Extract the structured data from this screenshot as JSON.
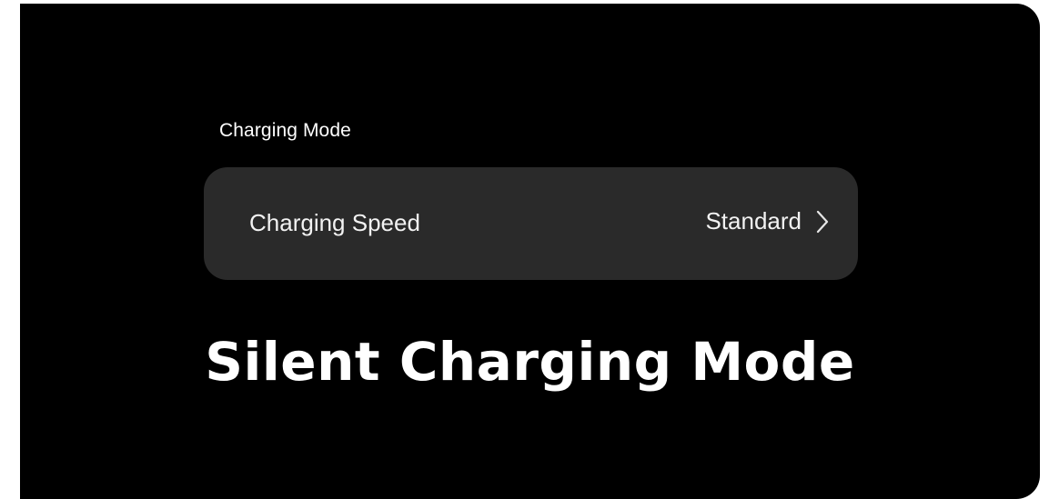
{
  "section": {
    "header": "Charging Mode"
  },
  "setting": {
    "label": "Charging Speed",
    "value": "Standard",
    "chevron_icon": "chevron-right-icon"
  },
  "caption": {
    "text": "Silent Charging Mode"
  },
  "colors": {
    "background": "#000000",
    "card": "#2a2a2a",
    "text": "#ffffff"
  }
}
